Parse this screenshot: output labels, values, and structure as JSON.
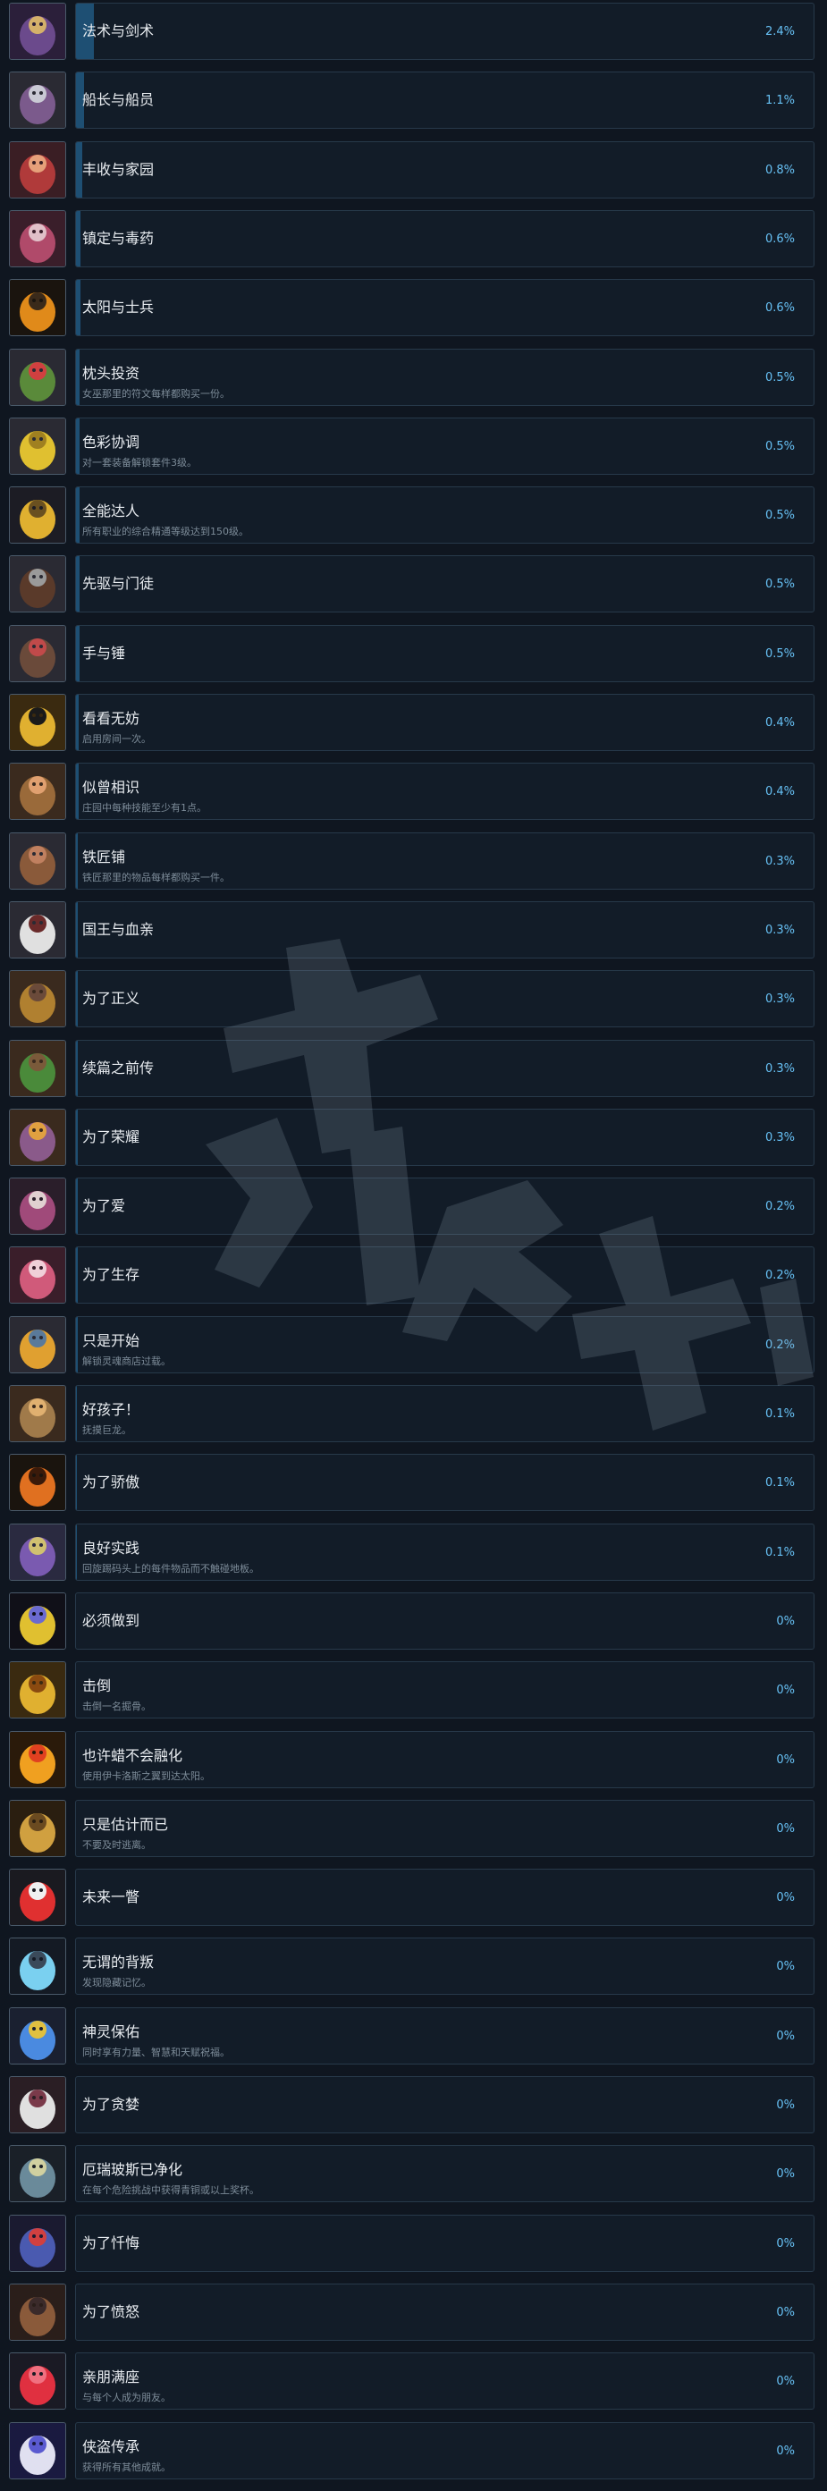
{
  "achievements": [
    {
      "name": "法术与剑术",
      "desc": "",
      "percent": "2.4%",
      "fill": 2.4,
      "icon": "wizard-icon",
      "colors": [
        "#2b1f3a",
        "#6b4a8c",
        "#d4b06a"
      ]
    },
    {
      "name": "船长与船员",
      "desc": "",
      "percent": "1.1%",
      "fill": 1.1,
      "icon": "pirate-icon",
      "colors": [
        "#2a2a33",
        "#7b5a8c",
        "#c9c9d4"
      ]
    },
    {
      "name": "丰收与家园",
      "desc": "",
      "percent": "0.8%",
      "fill": 0.8,
      "icon": "harvest-icon",
      "colors": [
        "#3a1e24",
        "#b03a3a",
        "#e6a07a"
      ]
    },
    {
      "name": "镇定与毒药",
      "desc": "",
      "percent": "0.6%",
      "fill": 0.6,
      "icon": "poison-icon",
      "colors": [
        "#3a1e2a",
        "#b04a6a",
        "#e0c0c8"
      ]
    },
    {
      "name": "太阳与士兵",
      "desc": "",
      "percent": "0.6%",
      "fill": 0.6,
      "icon": "sun-mask-icon",
      "colors": [
        "#1a140e",
        "#e08a1a",
        "#3a2a1a"
      ]
    },
    {
      "name": "枕头投资",
      "desc": "女巫那里的符文每样都购买一份。",
      "percent": "0.5%",
      "fill": 0.5,
      "icon": "witch-icon",
      "colors": [
        "#2a2a33",
        "#5a8a3a",
        "#d04040"
      ]
    },
    {
      "name": "色彩协调",
      "desc": "对一套装备解锁套件3级。",
      "percent": "0.5%",
      "fill": 0.5,
      "icon": "armor-icon",
      "colors": [
        "#2a2a33",
        "#e0c030",
        "#a08020"
      ]
    },
    {
      "name": "全能达人",
      "desc": "所有职业的综合精通等级达到150级。",
      "percent": "0.5%",
      "fill": 0.5,
      "icon": "wheel-icon",
      "colors": [
        "#1c1c24",
        "#e0b030",
        "#6a5020"
      ]
    },
    {
      "name": "先驱与门徒",
      "desc": "",
      "percent": "0.5%",
      "fill": 0.5,
      "icon": "herald-icon",
      "colors": [
        "#2a2a33",
        "#5a3a2a",
        "#9a9a9a"
      ]
    },
    {
      "name": "手与锤",
      "desc": "",
      "percent": "0.5%",
      "fill": 0.5,
      "icon": "hammer-icon",
      "colors": [
        "#2a2a33",
        "#6a4a3a",
        "#c04a4a"
      ]
    },
    {
      "name": "看看无妨",
      "desc": "启用房间一次。",
      "percent": "0.4%",
      "fill": 0.4,
      "icon": "eye-gear-icon",
      "colors": [
        "#3a2a10",
        "#e0b030",
        "#1a1a1a"
      ]
    },
    {
      "name": "似曾相识",
      "desc": "庄园中每种技能至少有1点。",
      "percent": "0.4%",
      "fill": 0.4,
      "icon": "manor-icon",
      "colors": [
        "#3a2a1e",
        "#9a6a3a",
        "#e0a070"
      ]
    },
    {
      "name": "铁匠铺",
      "desc": "铁匠那里的物品每样都购买一件。",
      "percent": "0.3%",
      "fill": 0.3,
      "icon": "blacksmith-icon",
      "colors": [
        "#2a2a33",
        "#8a5a3a",
        "#c08060"
      ]
    },
    {
      "name": "国王与血亲",
      "desc": "",
      "percent": "0.3%",
      "fill": 0.3,
      "icon": "king-icon",
      "colors": [
        "#2a2a33",
        "#e0e0e0",
        "#6a2a2a"
      ]
    },
    {
      "name": "为了正义",
      "desc": "",
      "percent": "0.3%",
      "fill": 0.3,
      "icon": "justice-icon",
      "colors": [
        "#3a2a1e",
        "#b08030",
        "#6a4a3a"
      ]
    },
    {
      "name": "续篇之前传",
      "desc": "",
      "percent": "0.3%",
      "fill": 0.3,
      "icon": "tree-icon",
      "colors": [
        "#3a2a1e",
        "#4a8a3a",
        "#7a5a3a"
      ]
    },
    {
      "name": "为了荣耀",
      "desc": "",
      "percent": "0.3%",
      "fill": 0.3,
      "icon": "glory-icon",
      "colors": [
        "#3a2a1e",
        "#8a5a8a",
        "#e0a040"
      ]
    },
    {
      "name": "为了爱",
      "desc": "",
      "percent": "0.2%",
      "fill": 0.2,
      "icon": "love-icon",
      "colors": [
        "#2a1e2a",
        "#a04a7a",
        "#e0d0d0"
      ]
    },
    {
      "name": "为了生存",
      "desc": "",
      "percent": "0.2%",
      "fill": 0.2,
      "icon": "survival-icon",
      "colors": [
        "#3a1e2a",
        "#d05a7a",
        "#f0d0d8"
      ]
    },
    {
      "name": "只是开始",
      "desc": "解锁灵魂商店过载。",
      "percent": "0.2%",
      "fill": 0.2,
      "icon": "lantern-icon",
      "colors": [
        "#2a2a33",
        "#e0a030",
        "#5a7a9a"
      ]
    },
    {
      "name": "好孩子！",
      "desc": "抚摸巨龙。",
      "percent": "0.1%",
      "fill": 0.1,
      "icon": "dragon-icon",
      "colors": [
        "#3a2a1e",
        "#a07a4a",
        "#e0b070"
      ]
    },
    {
      "name": "为了骄傲",
      "desc": "",
      "percent": "0.1%",
      "fill": 0.1,
      "icon": "pride-eye-icon",
      "colors": [
        "#1a140e",
        "#e07020",
        "#3a1a0a"
      ]
    },
    {
      "name": "良好实践",
      "desc": "回旋踢码头上的每件物品而不触碰地板。",
      "percent": "0.1%",
      "fill": 0.1,
      "icon": "practice-icon",
      "colors": [
        "#2a2a40",
        "#7a5ab0",
        "#d0c070"
      ]
    },
    {
      "name": "必须做到",
      "desc": "",
      "percent": "0%",
      "fill": 0,
      "icon": "legacy-logo-icon",
      "colors": [
        "#101018",
        "#e0c030",
        "#6a6ad0"
      ]
    },
    {
      "name": "击倒",
      "desc": "击倒一名掘骨。",
      "percent": "0%",
      "fill": 0,
      "icon": "ko-icon",
      "colors": [
        "#3a2a10",
        "#e0b030",
        "#8a4a10"
      ]
    },
    {
      "name": "也许蜡不会融化",
      "desc": "使用伊卡洛斯之翼到达太阳。",
      "percent": "0%",
      "fill": 0,
      "icon": "sun-wings-icon",
      "colors": [
        "#2a1a0a",
        "#f0a020",
        "#e04020"
      ]
    },
    {
      "name": "只是估计而已",
      "desc": "不要及时逃离。",
      "percent": "0%",
      "fill": 0,
      "icon": "clock-icon",
      "colors": [
        "#2a1e10",
        "#d0a040",
        "#6a4a20"
      ]
    },
    {
      "name": "未来一瞥",
      "desc": "",
      "percent": "0%",
      "fill": 0,
      "icon": "red-eye-icon",
      "colors": [
        "#1a1a20",
        "#e03030",
        "#f0f0f0"
      ]
    },
    {
      "name": "无谓的背叛",
      "desc": "发现隐藏记忆。",
      "percent": "0%",
      "fill": 0,
      "icon": "memory-orb-icon",
      "colors": [
        "#141a24",
        "#7ad0f0",
        "#3a4a5a"
      ]
    },
    {
      "name": "神灵保佑",
      "desc": "同时享有力量、智慧和天赋祝福。",
      "percent": "0%",
      "fill": 0,
      "icon": "blessing-icon",
      "colors": [
        "#1a2030",
        "#4a8ae0",
        "#e0c040"
      ]
    },
    {
      "name": "为了贪婪",
      "desc": "",
      "percent": "0%",
      "fill": 0,
      "icon": "greed-icon",
      "colors": [
        "#2a1e24",
        "#e0e0e0",
        "#7a3a4a"
      ]
    },
    {
      "name": "厄瑞玻斯已净化",
      "desc": "在每个危险挑战中获得青铜或以上奖杯。",
      "percent": "0%",
      "fill": 0,
      "icon": "erebus-icon",
      "colors": [
        "#1a2028",
        "#6a8a9a",
        "#d0d0a0"
      ]
    },
    {
      "name": "为了忏悔",
      "desc": "",
      "percent": "0%",
      "fill": 0,
      "icon": "penitence-icon",
      "colors": [
        "#1a1a30",
        "#4a5ab0",
        "#d04040"
      ]
    },
    {
      "name": "为了愤怒",
      "desc": "",
      "percent": "0%",
      "fill": 0,
      "icon": "wrath-icon",
      "colors": [
        "#2a1e1a",
        "#8a5a3a",
        "#3a2a2a"
      ]
    },
    {
      "name": "亲朋满座",
      "desc": "与每个人成为朋友。",
      "percent": "0%",
      "fill": 0,
      "icon": "hearts-icon",
      "colors": [
        "#1a1a24",
        "#e03040",
        "#f07080"
      ]
    },
    {
      "name": "侠盗传承",
      "desc": "获得所有其他成就。",
      "percent": "0%",
      "fill": 0,
      "icon": "legacy-2-icon",
      "colors": [
        "#1a1a40",
        "#e0e0f0",
        "#5a5ad0"
      ]
    }
  ]
}
